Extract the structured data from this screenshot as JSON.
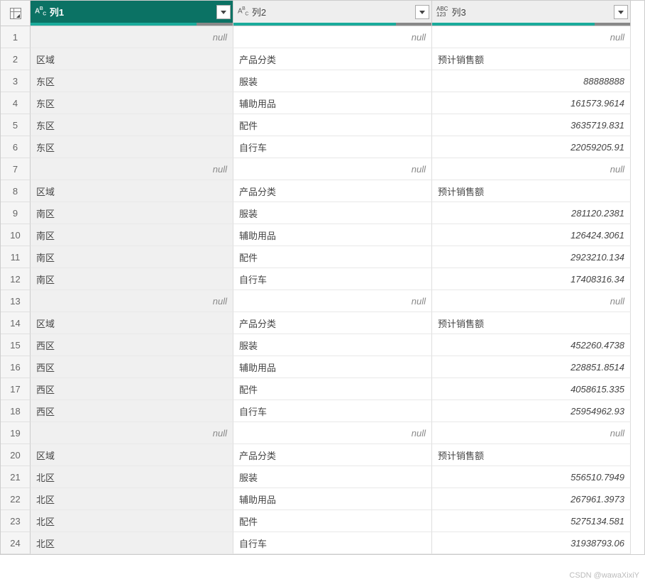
{
  "columns": [
    {
      "name": "列1",
      "type_label": "ABC",
      "type": "text",
      "selected": true
    },
    {
      "name": "列2",
      "type_label": "ABC",
      "type": "text",
      "selected": false
    },
    {
      "name": "列3",
      "type_label": "ABC123",
      "type": "any",
      "selected": false
    }
  ],
  "null_label": "null",
  "rows": [
    {
      "n": 1,
      "c1": null,
      "c2": null,
      "c3": null
    },
    {
      "n": 2,
      "c1": "区域",
      "c2": "产品分类",
      "c3": "预计销售额"
    },
    {
      "n": 3,
      "c1": "东区",
      "c2": "服装",
      "c3": "88888888"
    },
    {
      "n": 4,
      "c1": "东区",
      "c2": "辅助用品",
      "c3": "161573.9614"
    },
    {
      "n": 5,
      "c1": "东区",
      "c2": "配件",
      "c3": "3635719.831"
    },
    {
      "n": 6,
      "c1": "东区",
      "c2": "自行车",
      "c3": "22059205.91"
    },
    {
      "n": 7,
      "c1": null,
      "c2": null,
      "c3": null
    },
    {
      "n": 8,
      "c1": "区域",
      "c2": "产品分类",
      "c3": "预计销售额"
    },
    {
      "n": 9,
      "c1": "南区",
      "c2": "服装",
      "c3": "281120.2381"
    },
    {
      "n": 10,
      "c1": "南区",
      "c2": "辅助用品",
      "c3": "126424.3061"
    },
    {
      "n": 11,
      "c1": "南区",
      "c2": "配件",
      "c3": "2923210.134"
    },
    {
      "n": 12,
      "c1": "南区",
      "c2": "自行车",
      "c3": "17408316.34"
    },
    {
      "n": 13,
      "c1": null,
      "c2": null,
      "c3": null
    },
    {
      "n": 14,
      "c1": "区域",
      "c2": "产品分类",
      "c3": "预计销售额"
    },
    {
      "n": 15,
      "c1": "西区",
      "c2": "服装",
      "c3": "452260.4738"
    },
    {
      "n": 16,
      "c1": "西区",
      "c2": "辅助用品",
      "c3": "228851.8514"
    },
    {
      "n": 17,
      "c1": "西区",
      "c2": "配件",
      "c3": "4058615.335"
    },
    {
      "n": 18,
      "c1": "西区",
      "c2": "自行车",
      "c3": "25954962.93"
    },
    {
      "n": 19,
      "c1": null,
      "c2": null,
      "c3": null
    },
    {
      "n": 20,
      "c1": "区域",
      "c2": "产品分类",
      "c3": "预计销售额"
    },
    {
      "n": 21,
      "c1": "北区",
      "c2": "服装",
      "c3": "556510.7949"
    },
    {
      "n": 22,
      "c1": "北区",
      "c2": "辅助用品",
      "c3": "267961.3973"
    },
    {
      "n": 23,
      "c1": "北区",
      "c2": "配件",
      "c3": "5275134.581"
    },
    {
      "n": 24,
      "c1": "北区",
      "c2": "自行车",
      "c3": "31938793.06"
    }
  ],
  "numeric_header_text": "预计销售额",
  "watermark": "CSDN @wawaXixiY"
}
